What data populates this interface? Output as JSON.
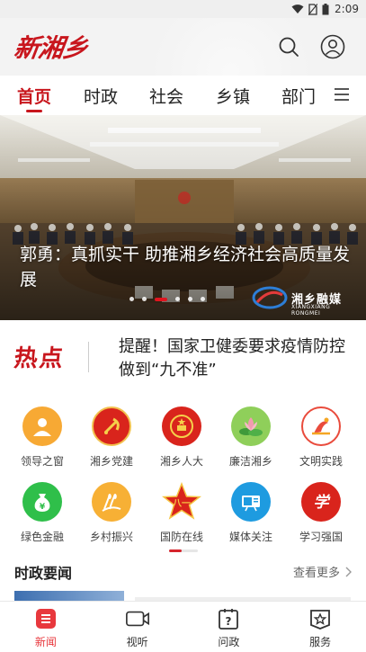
{
  "status_bar": {
    "time": "2:09"
  },
  "app": {
    "logo_text": "新湘乡"
  },
  "tabs": [
    {
      "label": "首页",
      "active": true
    },
    {
      "label": "时政"
    },
    {
      "label": "社会"
    },
    {
      "label": "乡镇"
    },
    {
      "label": "部门"
    }
  ],
  "banner": {
    "caption": "郭勇：真抓实干 助推湘乡经济社会高质量发展",
    "watermark": "湘乡融媒",
    "watermark_sub": "XIANGXIANG RONGMEI",
    "slide_count": 6,
    "active_slide": 3
  },
  "hot": {
    "label": "热点",
    "headline": "提醒！国家卫健委要求疫情防控做到“九不准”"
  },
  "services": [
    {
      "label": "领导之窗",
      "icon": "leader-icon",
      "color": "#f5a623"
    },
    {
      "label": "湘乡党建",
      "icon": "party-emblem-icon",
      "color": "#d9241c"
    },
    {
      "label": "湘乡人大",
      "icon": "national-emblem-icon",
      "color": "#d9241c"
    },
    {
      "label": "廉洁湘乡",
      "icon": "lotus-icon",
      "color": "#7cc142"
    },
    {
      "label": "文明实践",
      "icon": "civilization-icon",
      "color": "#e94b3c"
    },
    {
      "label": "绿色金融",
      "icon": "money-bag-icon",
      "color": "#31b34a"
    },
    {
      "label": "乡村振兴",
      "icon": "wheat-icon",
      "color": "#f5a623"
    },
    {
      "label": "国防在线",
      "icon": "army-star-icon",
      "color": "#d9241c"
    },
    {
      "label": "媒体关注",
      "icon": "media-icon",
      "color": "#1e9be0"
    },
    {
      "label": "学习强国",
      "icon": "xuexi-icon",
      "color": "#d9241c"
    }
  ],
  "news_section": {
    "title": "时政要闻",
    "more_label": "查看更多"
  },
  "bottom_nav": [
    {
      "label": "新闻",
      "icon": "news-icon",
      "active": true
    },
    {
      "label": "视听",
      "icon": "video-icon"
    },
    {
      "label": "问政",
      "icon": "question-icon"
    },
    {
      "label": "服务",
      "icon": "service-icon"
    }
  ],
  "colors": {
    "brand_red": "#c8161d",
    "accent_red": "#e8383d"
  }
}
